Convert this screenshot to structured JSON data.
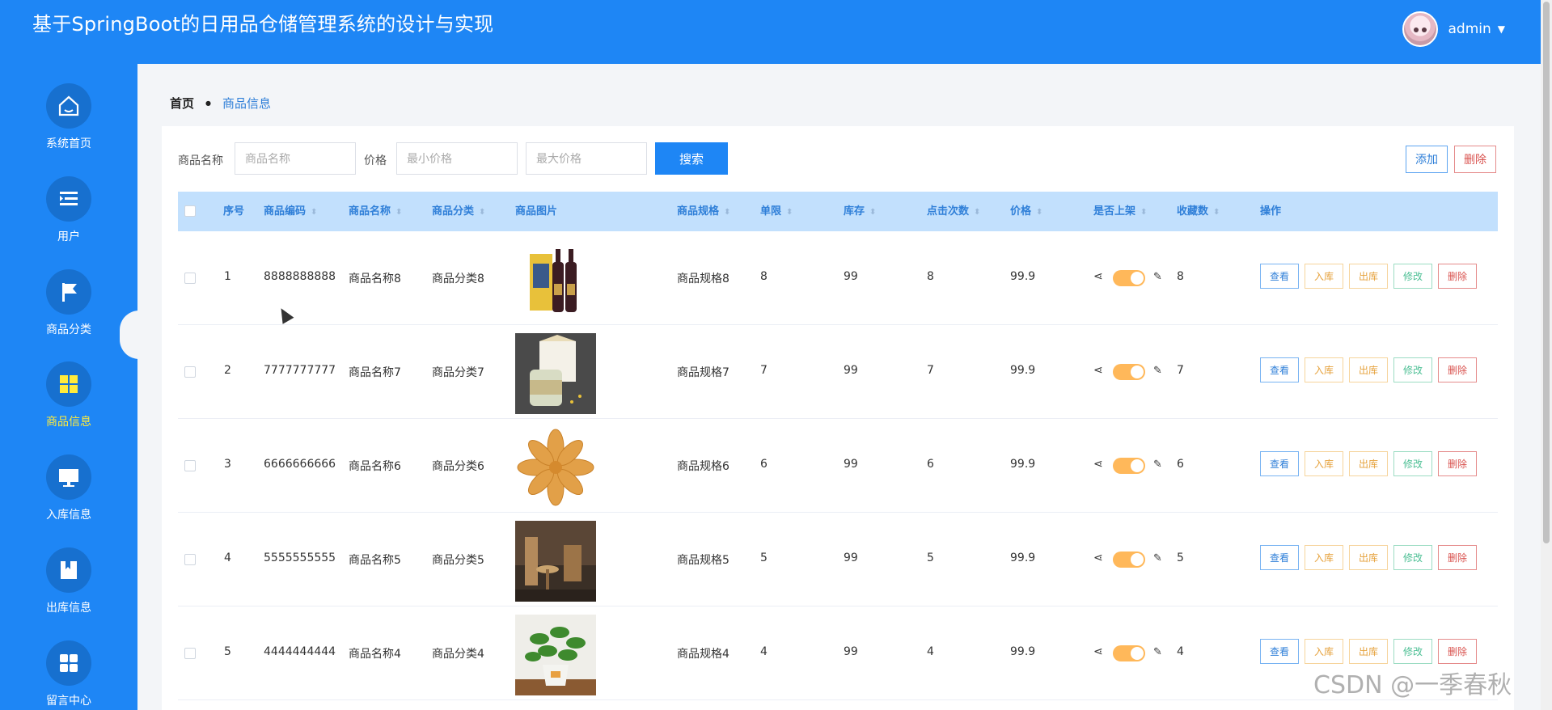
{
  "app": {
    "title": "基于SpringBoot的日用品仓储管理系统的设计与实现",
    "user": "admin"
  },
  "sidebar": {
    "items": [
      {
        "label": "系统首页",
        "icon": "home-icon"
      },
      {
        "label": "用户",
        "icon": "list-icon"
      },
      {
        "label": "商品分类",
        "icon": "flag-icon"
      },
      {
        "label": "商品信息",
        "icon": "grid-icon",
        "active": true
      },
      {
        "label": "入库信息",
        "icon": "monitor-icon"
      },
      {
        "label": "出库信息",
        "icon": "book-icon"
      },
      {
        "label": "留言中心",
        "icon": "apps-icon"
      }
    ]
  },
  "breadcrumb": {
    "home": "首页",
    "current": "商品信息"
  },
  "search": {
    "name_label": "商品名称",
    "name_placeholder": "商品名称",
    "price_label": "价格",
    "min_placeholder": "最小价格",
    "max_placeholder": "最大价格",
    "search_button": "搜索",
    "add_button": "添加",
    "delete_button": "删除"
  },
  "table": {
    "headers": {
      "index": "序号",
      "code": "商品编码",
      "name": "商品名称",
      "category": "商品分类",
      "image": "商品图片",
      "spec": "商品规格",
      "limit": "单限",
      "stock": "库存",
      "clicks": "点击次数",
      "price": "价格",
      "listed": "是否上架",
      "favorites": "收藏数",
      "ops": "操作"
    },
    "ops": {
      "view": "查看",
      "in": "入库",
      "out": "出库",
      "edit": "修改",
      "del": "删除"
    },
    "rows": [
      {
        "index": "1",
        "code": "8888888888",
        "name": "商品名称8",
        "category": "商品分类8",
        "image": "wine-gift-box",
        "spec": "商品规格8",
        "limit": "8",
        "stock": "99",
        "clicks": "8",
        "price": "99.9",
        "favorites": "8"
      },
      {
        "index": "2",
        "code": "7777777777",
        "name": "商品名称7",
        "category": "商品分类7",
        "image": "glass-jar-box",
        "spec": "商品规格7",
        "limit": "7",
        "stock": "99",
        "clicks": "7",
        "price": "99.9",
        "favorites": "7"
      },
      {
        "index": "3",
        "code": "6666666666",
        "name": "商品名称6",
        "category": "商品分类6",
        "image": "fried-snack",
        "spec": "商品规格6",
        "limit": "6",
        "stock": "99",
        "clicks": "6",
        "price": "99.9",
        "favorites": "6"
      },
      {
        "index": "4",
        "code": "5555555555",
        "name": "商品名称5",
        "category": "商品分类5",
        "image": "furniture-room",
        "spec": "商品规格5",
        "limit": "5",
        "stock": "99",
        "clicks": "5",
        "price": "99.9",
        "favorites": "5"
      },
      {
        "index": "5",
        "code": "4444444444",
        "name": "商品名称4",
        "category": "商品分类4",
        "image": "potted-plant",
        "spec": "商品规格4",
        "limit": "4",
        "stock": "99",
        "clicks": "4",
        "price": "99.9",
        "favorites": "4"
      }
    ]
  },
  "watermark": "CSDN @一季春秋"
}
